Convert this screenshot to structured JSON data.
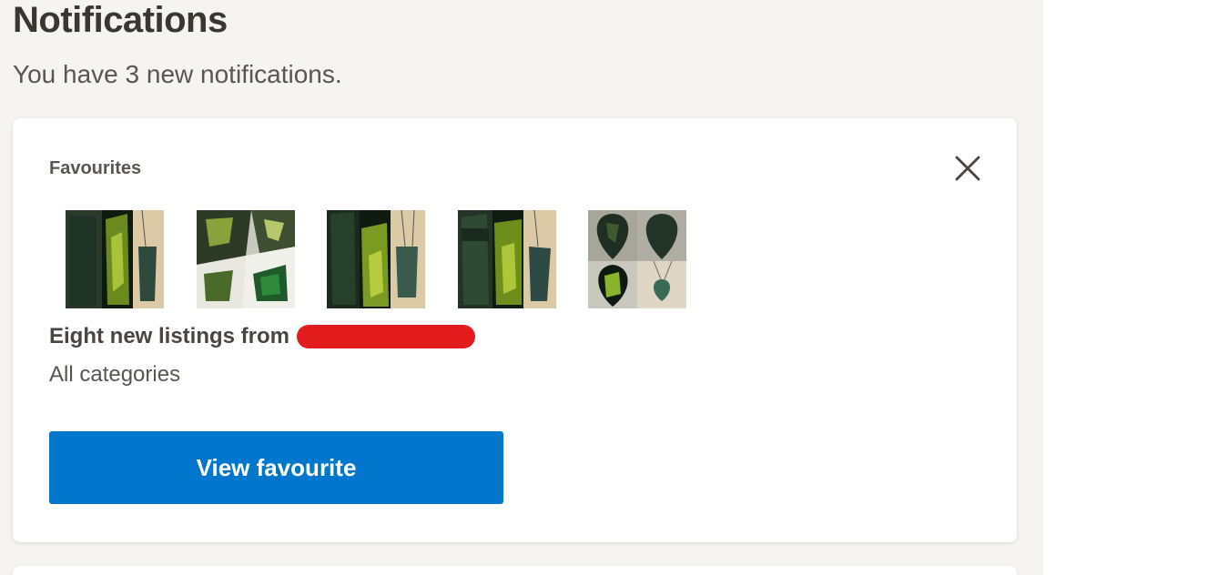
{
  "header": {
    "title": "Notifications",
    "subtitle": "You have 3 new notifications."
  },
  "notification": {
    "section_label": "Favourites",
    "close_icon": "close-icon",
    "headline": "Eight new listings from",
    "sender_redacted": true,
    "category": "All categories",
    "button_label": "View favourite",
    "thumbnails": [
      {
        "name": "listing-thumbnail-1",
        "alt": "greenstone pieces"
      },
      {
        "name": "listing-thumbnail-2",
        "alt": "greenstone offcuts"
      },
      {
        "name": "listing-thumbnail-3",
        "alt": "greenstone pendant"
      },
      {
        "name": "listing-thumbnail-4",
        "alt": "greenstone toki"
      },
      {
        "name": "listing-thumbnail-5",
        "alt": "greenstone heart pendant"
      }
    ]
  },
  "colors": {
    "panel_bg": "#f5f4f2",
    "button_bg": "#0077cc",
    "redaction": "#e21c1c",
    "text_dark": "#3a3632"
  }
}
